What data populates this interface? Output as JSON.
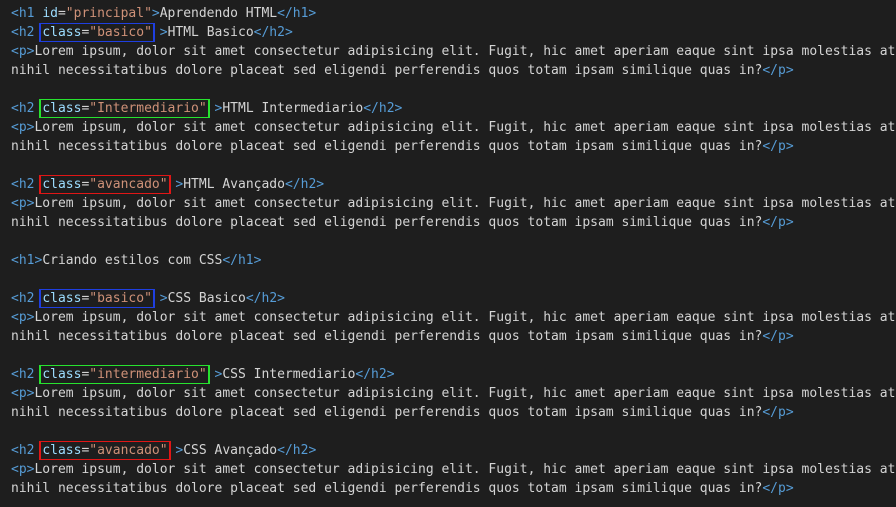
{
  "lines": {
    "l01": {
      "open": "<h1",
      "attr": "id",
      "eq": "=",
      "val": "\"principal\"",
      "close": ">",
      "text": "Aprendendo HTML",
      "end": "</h1>"
    },
    "l02": {
      "open": "<h2",
      "attr": "class",
      "eq": "=",
      "val": "\"basico\"",
      "close": " >",
      "text": "HTML Basico",
      "end": "</h2>"
    },
    "l03": {
      "open": "<p>",
      "text": "Lorem ipsum, dolor sit amet consectetur adipisicing elit. Fugit, hic amet aperiam eaque sint ipsa molestias at"
    },
    "l04": {
      "text": "nihil necessitatibus dolore placeat sed eligendi perferendis quos totam ipsam similique quas in?",
      "end": "</p>"
    },
    "l06": {
      "open": "<h2",
      "attr": "class",
      "eq": "=",
      "val": "\"Intermediario\"",
      "close": " >",
      "text": "HTML Intermediario",
      "end": "</h2>"
    },
    "l07": {
      "open": "<p>",
      "text": "Lorem ipsum, dolor sit amet consectetur adipisicing elit. Fugit, hic amet aperiam eaque sint ipsa molestias at"
    },
    "l08": {
      "text": "nihil necessitatibus dolore placeat sed eligendi perferendis quos totam ipsam similique quas in?",
      "end": "</p>"
    },
    "l10": {
      "open": "<h2",
      "attr": "class",
      "eq": "=",
      "val": "\"avancado\"",
      "close": " >",
      "text": "HTML Avançado",
      "end": "</h2>"
    },
    "l11": {
      "open": "<p>",
      "text": "Lorem ipsum, dolor sit amet consectetur adipisicing elit. Fugit, hic amet aperiam eaque sint ipsa molestias at"
    },
    "l12": {
      "text": "nihil necessitatibus dolore placeat sed eligendi perferendis quos totam ipsam similique quas in?",
      "end": "</p>"
    },
    "l14": {
      "open": "<h1>",
      "text": "Criando estilos com CSS",
      "end": "</h1>"
    },
    "l16": {
      "open": "<h2",
      "attr": "class",
      "eq": "=",
      "val": "\"basico\"",
      "close": " >",
      "text": "CSS Basico",
      "end": "</h2>"
    },
    "l17": {
      "open": "<p>",
      "text": "Lorem ipsum, dolor sit amet consectetur adipisicing elit. Fugit, hic amet aperiam eaque sint ipsa molestias at"
    },
    "l18": {
      "text": "nihil necessitatibus dolore placeat sed eligendi perferendis quos totam ipsam similique quas in?",
      "end": "</p>"
    },
    "l20": {
      "open": "<h2",
      "attr": "class",
      "eq": "=",
      "val": "\"intermediario\"",
      "close": " >",
      "text": "CSS Intermediario",
      "end": "</h2>"
    },
    "l21": {
      "open": "<p>",
      "text": "Lorem ipsum, dolor sit amet consectetur adipisicing elit. Fugit, hic amet aperiam eaque sint ipsa molestias at"
    },
    "l22": {
      "text": "nihil necessitatibus dolore placeat sed eligendi perferendis quos totam ipsam similique quas in?",
      "end": "</p>"
    },
    "l24": {
      "open": "<h2",
      "attr": "class",
      "eq": "=",
      "val": "\"avancado\"",
      "close": " >",
      "text": "CSS Avançado",
      "end": "</h2>"
    },
    "l25": {
      "open": "<p>",
      "text": "Lorem ipsum, dolor sit amet consectetur adipisicing elit. Fugit, hic amet aperiam eaque sint ipsa molestias at"
    },
    "l26": {
      "text": "nihil necessitatibus dolore placeat sed eligendi perferendis quos totam ipsam similique quas in?",
      "end": "</p>"
    }
  },
  "colors": {
    "background": "#1e1e1e",
    "tag": "#569cd6",
    "attribute": "#9cdcfe",
    "string": "#ce9178",
    "text": "#d4d4d4",
    "highlight_basico": "#1f3fe0",
    "highlight_intermediario": "#27e22f",
    "highlight_avancado": "#e01616"
  }
}
